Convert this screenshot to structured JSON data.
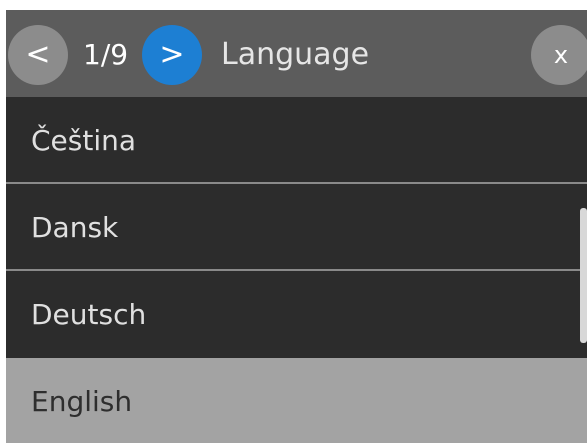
{
  "header": {
    "prev_label": "<",
    "page_indicator": "1/9",
    "next_label": ">",
    "title": "Language",
    "close_label": "x"
  },
  "list": {
    "items": [
      {
        "label": "Čeština"
      },
      {
        "label": "Dansk"
      },
      {
        "label": "Deutsch"
      },
      {
        "label": "English",
        "selected": true
      }
    ]
  },
  "colors": {
    "header_bg": "#5c5c5c",
    "list_bg": "#2c2c2c",
    "accent_next_button": "#1d7fd3",
    "nav_button_gray": "#8c8c8c",
    "selected_item_bg": "#a3a3a3"
  }
}
